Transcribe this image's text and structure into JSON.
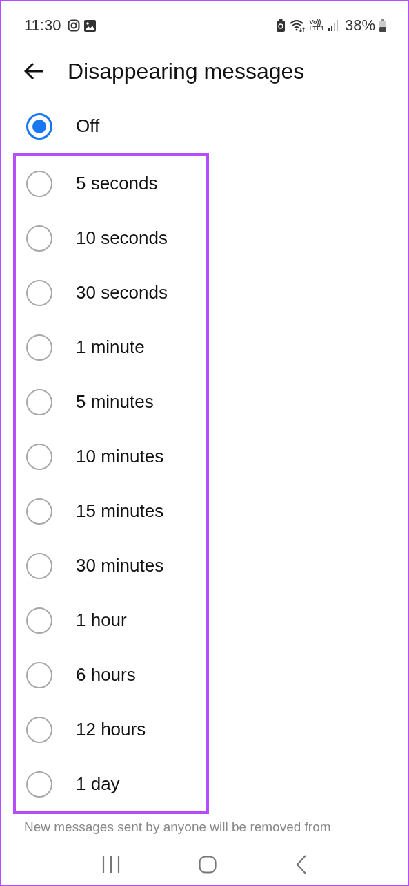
{
  "status_bar": {
    "time": "11:30",
    "volte": "Vo))",
    "network": "LTE1",
    "battery": "38%"
  },
  "header": {
    "title": "Disappearing messages"
  },
  "options": [
    {
      "label": "Off",
      "selected": true
    }
  ],
  "highlighted_options": [
    {
      "label": "5 seconds",
      "selected": false
    },
    {
      "label": "10 seconds",
      "selected": false
    },
    {
      "label": "30 seconds",
      "selected": false
    },
    {
      "label": "1 minute",
      "selected": false
    },
    {
      "label": "5 minutes",
      "selected": false
    },
    {
      "label": "10 minutes",
      "selected": false
    },
    {
      "label": "15 minutes",
      "selected": false
    },
    {
      "label": "30 minutes",
      "selected": false
    },
    {
      "label": "1 hour",
      "selected": false
    },
    {
      "label": "6 hours",
      "selected": false
    },
    {
      "label": "12 hours",
      "selected": false
    },
    {
      "label": "1 day",
      "selected": false
    }
  ],
  "footer_note": "New messages sent by anyone will be removed from"
}
